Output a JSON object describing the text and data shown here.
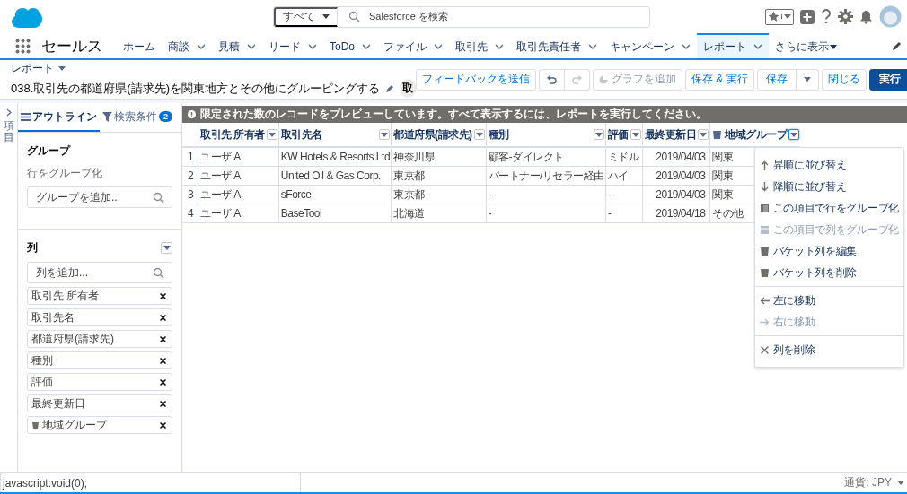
{
  "header": {
    "search_scope": "すべて",
    "search_placeholder": "Salesforce を検索"
  },
  "nav": {
    "app_name": "セールス",
    "tabs": [
      {
        "label": "ホーム",
        "kind": "plain",
        "selected": false
      },
      {
        "label": "商談",
        "kind": "menu",
        "selected": false
      },
      {
        "label": "見積",
        "kind": "menu",
        "selected": false
      },
      {
        "label": "リード",
        "kind": "menu",
        "selected": false
      },
      {
        "label": "ToDo",
        "kind": "menu",
        "selected": false
      },
      {
        "label": "ファイル",
        "kind": "menu",
        "selected": false
      },
      {
        "label": "取引先",
        "kind": "menu",
        "selected": false
      },
      {
        "label": "取引先責任者",
        "kind": "menu",
        "selected": false
      },
      {
        "label": "キャンペーン",
        "kind": "menu",
        "selected": false
      },
      {
        "label": "レポート",
        "kind": "menu",
        "selected": true
      },
      {
        "label": "さらに表示",
        "kind": "more",
        "selected": false
      }
    ]
  },
  "title": {
    "object_label": "レポート",
    "report_name": "038.取引先の都道府県(請求先)を関東地方とその他にグルーピングする",
    "badge": "取"
  },
  "toolbar": [
    {
      "kind": "button",
      "label": "フィードバックを送信",
      "disabled": false
    },
    {
      "kind": "undo",
      "disabled": false
    },
    {
      "kind": "redo",
      "disabled": true
    },
    {
      "kind": "chart",
      "label": "グラフを追加",
      "disabled": true
    },
    {
      "kind": "button",
      "label": "保存 & 実行",
      "disabled": false
    },
    {
      "kind": "split",
      "label": "保存",
      "disabled": false
    },
    {
      "kind": "button",
      "label": "閉じる",
      "disabled": false
    },
    {
      "kind": "primary",
      "label": "実行",
      "disabled": false
    }
  ],
  "sidebar": {
    "rail_label": "項目",
    "tabs": [
      {
        "label": "アウトライン",
        "kind": "outline",
        "selected": true
      },
      {
        "label": "検索条件",
        "kind": "filter",
        "count": "2",
        "selected": false
      }
    ],
    "group_title": "グループ",
    "group_subtitle": "行をグループ化",
    "group_placeholder": "グループを追加...",
    "columns_title": "列",
    "columns_placeholder": "列を追加...",
    "columns": [
      {
        "label": "取引先 所有者",
        "bucket": false
      },
      {
        "label": "取引先名",
        "bucket": false
      },
      {
        "label": "都道府県(請求先)",
        "bucket": false
      },
      {
        "label": "種別",
        "bucket": false
      },
      {
        "label": "評価",
        "bucket": false
      },
      {
        "label": "最終更新日",
        "bucket": false
      },
      {
        "label": "地域グループ",
        "bucket": true
      }
    ]
  },
  "table": {
    "notice": "限定された数のレコードをプレビューしています。すべて表示するには、レポートを実行してください。",
    "columns": [
      {
        "label": "取引先 所有者",
        "kind": "text",
        "bucket": false,
        "menu_open": false
      },
      {
        "label": "取引先名",
        "kind": "text",
        "bucket": false,
        "menu_open": false
      },
      {
        "label": "都道府県(請求先)",
        "kind": "text",
        "bucket": false,
        "menu_open": false
      },
      {
        "label": "種別",
        "kind": "text",
        "bucket": false,
        "menu_open": false
      },
      {
        "label": "評価",
        "kind": "text",
        "bucket": false,
        "menu_open": false
      },
      {
        "label": "最終更新日",
        "kind": "date",
        "bucket": false,
        "menu_open": false
      },
      {
        "label": "地域グループ",
        "kind": "text",
        "bucket": true,
        "menu_open": true
      }
    ],
    "rows": [
      {
        "number": "1",
        "cells": [
          "ユーザ A",
          "KW Hotels & Resorts Ltd",
          "神奈川県",
          "顧客-ダイレクト",
          "ミドル",
          "2019/04/03",
          "関東"
        ]
      },
      {
        "number": "2",
        "cells": [
          "ユーザ A",
          "United Oil & Gas Corp.",
          "東京都",
          "パートナー/リセラー経由",
          "ハイ",
          "2019/04/03",
          "関東"
        ]
      },
      {
        "number": "3",
        "cells": [
          "ユーザ A",
          "sForce",
          "東京都",
          "-",
          "-",
          "2019/04/03",
          "関東"
        ]
      },
      {
        "number": "4",
        "cells": [
          "ユーザ A",
          "BaseTool",
          "北海道",
          "-",
          "-",
          "2019/04/18",
          "その他"
        ]
      }
    ]
  },
  "column_menu": {
    "groups": [
      [
        {
          "label": "昇順に並び替え",
          "kind": "sort-up",
          "disabled": false
        },
        {
          "label": "降順に並び替え",
          "kind": "sort-down",
          "disabled": false
        },
        {
          "label": "この項目で行をグループ化",
          "kind": "group-rows",
          "disabled": false
        },
        {
          "label": "この項目で列をグループ化",
          "kind": "group-cols",
          "disabled": true
        },
        {
          "label": "バケット列を編集",
          "kind": "bucket",
          "disabled": false
        },
        {
          "label": "バケット列を削除",
          "kind": "bucket",
          "disabled": false
        }
      ],
      [
        {
          "label": "左に移動",
          "kind": "left",
          "disabled": false
        },
        {
          "label": "右に移動",
          "kind": "right",
          "disabled": true
        }
      ],
      [
        {
          "label": "列を削除",
          "kind": "remove",
          "disabled": false
        }
      ]
    ]
  },
  "footer": {
    "status_url": "javascript:void(0);",
    "currency": "通貨: JPY"
  }
}
